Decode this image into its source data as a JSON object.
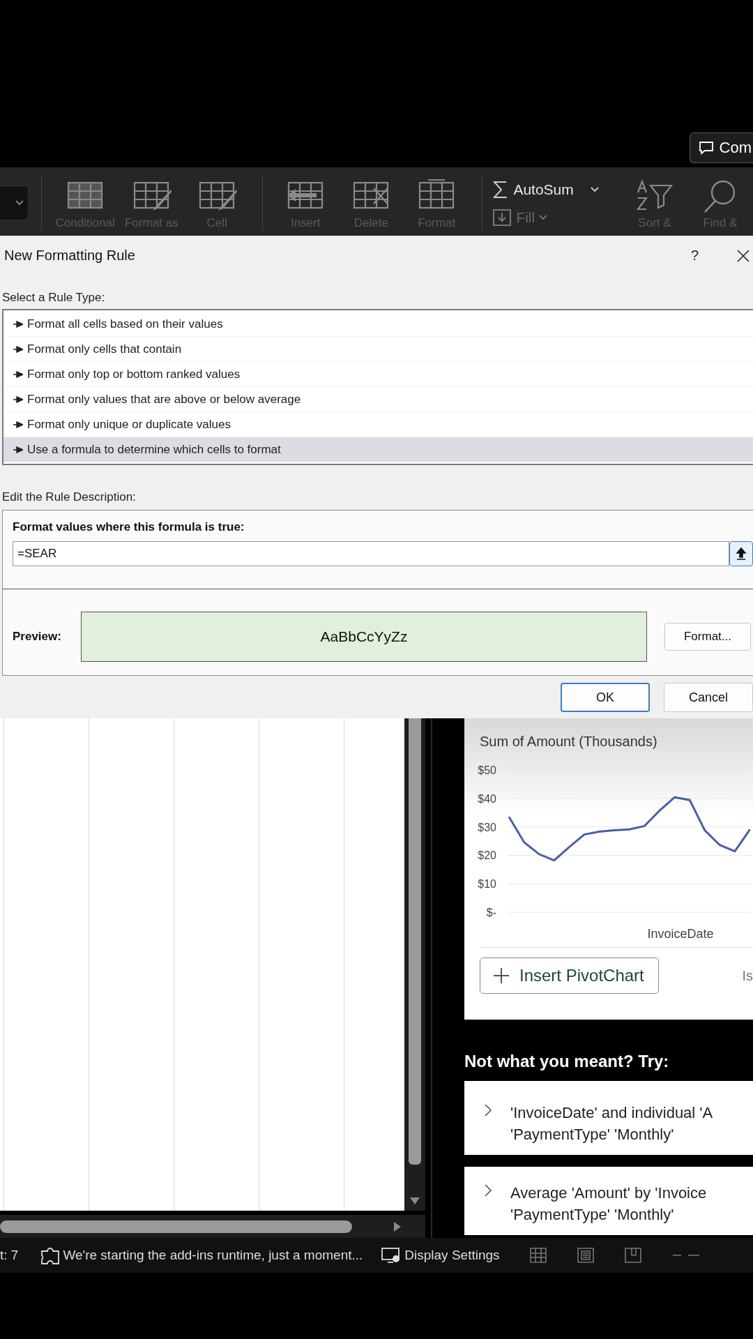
{
  "comments_button": {
    "label": "Com"
  },
  "ribbon": {
    "cells": [
      {
        "kind": "conditional",
        "label": "Conditional"
      },
      {
        "kind": "table",
        "label": "Format as"
      },
      {
        "kind": "cellstyle",
        "label": "Cell"
      },
      {
        "kind": "insert",
        "label": "Insert"
      },
      {
        "kind": "delete",
        "label": "Delete"
      },
      {
        "kind": "format",
        "label": "Format"
      }
    ],
    "autosum": {
      "label": "AutoSum"
    },
    "fill": {
      "label": "Fill"
    },
    "editing": [
      {
        "kind": "sort",
        "label": "Sort &"
      },
      {
        "kind": "find",
        "label": "Find &"
      }
    ]
  },
  "dialog": {
    "title": "New Formatting Rule",
    "help": "?",
    "rule_type_label": "Select a Rule Type:",
    "rule_types": [
      {
        "label": "Format all cells based on their values",
        "selected": false
      },
      {
        "label": "Format only cells that contain",
        "selected": false
      },
      {
        "label": "Format only top or bottom ranked values",
        "selected": false
      },
      {
        "label": "Format only values that are above or below average",
        "selected": false
      },
      {
        "label": "Format only unique or duplicate values",
        "selected": false
      },
      {
        "label": "Use a formula to determine which cells to format",
        "selected": true
      }
    ],
    "description_label": "Edit the Rule Description:",
    "formula_label": "Format values where this formula is true:",
    "formula_value": "=SEAR",
    "preview_label": "Preview:",
    "preview_sample": "AaBbCcYyZz",
    "format_button": "Format...",
    "buttons": [
      {
        "label": "OK",
        "default": true
      },
      {
        "label": "Cancel",
        "default": false
      }
    ]
  },
  "chart_card": {
    "chart_data": {
      "type": "line",
      "title": "Sum of Amount (Thousands)",
      "xlabel": "InvoiceDate",
      "ylim": [
        0,
        50
      ],
      "grid": true,
      "yticks": [
        {
          "value": 0,
          "label": "$-"
        },
        {
          "value": 10,
          "label": "$10"
        },
        {
          "value": 20,
          "label": "$20"
        },
        {
          "value": 30,
          "label": "$30"
        },
        {
          "value": 40,
          "label": "$40"
        },
        {
          "value": 50,
          "label": "$50"
        }
      ],
      "values": [
        33.5,
        24.6,
        20.4,
        18.2,
        22.9,
        27.3,
        28.3,
        28.8,
        29.1,
        30.3,
        35.7,
        40.4,
        39.4,
        28.8,
        23.6,
        21.4,
        29.1
      ]
    },
    "insert_button": "Insert PivotChart",
    "cut_text": "Is"
  },
  "suggestions_heading": "Not what you meant? Try:",
  "suggestions": [
    {
      "lines": [
        "'InvoiceDate' and individual 'A",
        "'PaymentType' 'Monthly'"
      ]
    },
    {
      "lines": [
        "Average 'Amount' by 'Invoice",
        "'PaymentType' 'Monthly'"
      ]
    }
  ],
  "status_bar": {
    "cell_count": "t: 7",
    "message": "We're starting the add-ins runtime, just a moment...",
    "display_settings": "Display Settings"
  }
}
